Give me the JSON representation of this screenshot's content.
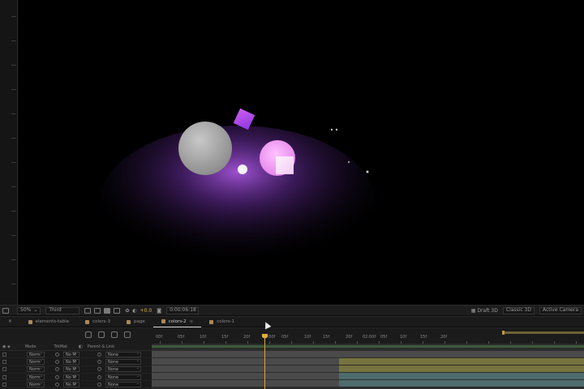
{
  "viewer": {
    "zoom": "50%",
    "camera_view": "Third",
    "exposure": "+0.0",
    "timecode": "0:00:06:18",
    "renderer_mode": "Draft 3D",
    "renderer": "Classic 3D",
    "active_camera": "Active Camera"
  },
  "tabs": [
    {
      "label": "elements-table",
      "active": false
    },
    {
      "label": "colors-3",
      "active": false
    },
    {
      "label": "page",
      "active": false
    },
    {
      "label": "colors-2",
      "active": true,
      "close": "≡"
    },
    {
      "label": "colors-1",
      "active": false
    }
  ],
  "timeline": {
    "ruler_labels": [
      "00f",
      "05f",
      "10f",
      "15f",
      "20f",
      "01:00f",
      "05f",
      "10f",
      "15f",
      "20f",
      "02:00f",
      "05f",
      "10f",
      "15f",
      "20f"
    ],
    "columns": [
      "Mode",
      "TrkMat",
      "Parent & Link"
    ],
    "layers": [
      {
        "mode": "Norm",
        "trkmat": "No M",
        "parent": "None"
      },
      {
        "mode": "Norm",
        "trkmat": "No M",
        "parent": "None"
      },
      {
        "mode": "Norm",
        "trkmat": "No M",
        "parent": "None"
      },
      {
        "mode": "Norm",
        "trkmat": "No M",
        "parent": "None"
      },
      {
        "mode": "Norm",
        "trkmat": "No M",
        "parent": "None"
      }
    ]
  },
  "colors": {
    "accent": "#d9b44a",
    "shape_purple": "#b34df0",
    "shape_pink": "#f59af5"
  },
  "icons": [
    "camera-icon",
    "grid-icon",
    "mask-icon",
    "region-icon",
    "color-wheel-icon",
    "snapshot-icon",
    "search-icon",
    "solo-icon",
    "lock-icon"
  ]
}
